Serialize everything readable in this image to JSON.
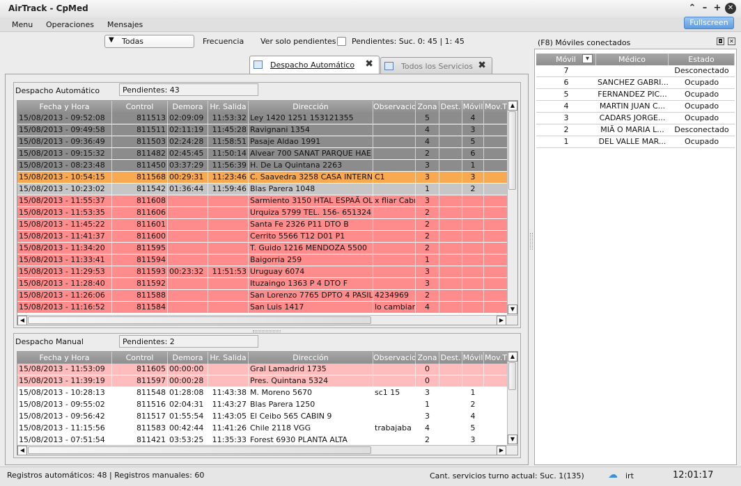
{
  "app": {
    "title": "AirTrack - CpMed",
    "fullscreen_label": "Fullscreen"
  },
  "menu": [
    "Menu",
    "Operaciones",
    "Mensajes"
  ],
  "filter": {
    "selected": "Todas",
    "frecuencia_label": "Frecuencia",
    "ver_pendientes_label": "Ver solo pendientes",
    "pendientes_text": "Pendientes: Suc. 0: 45  |  1: 45"
  },
  "tabs": [
    {
      "label": "Despacho Automático",
      "active": true
    },
    {
      "label": "Todos los Servicios",
      "active": false
    }
  ],
  "auto": {
    "title": "Despacho Automático",
    "pendientes": "Pendientes: 43"
  },
  "manual": {
    "title": "Despacho Manual",
    "pendientes": "Pendientes: 2"
  },
  "columns": [
    "Fecha y Hora",
    "Control",
    "Demora",
    "Hr. Salida",
    "Dirección",
    "Observacion",
    "Zona",
    "Dest.",
    "Móvil",
    "Mov.T"
  ],
  "colors": {
    "dark": "#8c8c8c",
    "orange": "#f9a94f",
    "light": "#c6c6c6",
    "red": "#ff8c8c",
    "pink": "#ffbcbc",
    "white": "#ffffff"
  },
  "auto_rows": [
    [
      "15/08/2013 - 09:52:08",
      "811513",
      "02:09:09",
      "11:53:32",
      "Ley 1420 1251     153121355",
      "",
      "5",
      "",
      "4",
      "",
      "dark"
    ],
    [
      "15/08/2013 - 09:49:58",
      "811511",
      "02:11:19",
      "11:45:28",
      "Ravignani 1354",
      "",
      "4",
      "",
      "3",
      "",
      "dark"
    ],
    [
      "15/08/2013 - 09:36:49",
      "811503",
      "02:24:28",
      "11:58:51",
      "Pasaje Aldao 1991",
      "",
      "4",
      "",
      "5",
      "",
      "dark"
    ],
    [
      "15/08/2013 - 09:15:32",
      "811482",
      "02:45:45",
      "11:50:14",
      "Alvear 700     SANAT PARQUE HAE",
      "",
      "2",
      "",
      "6",
      "",
      "dark"
    ],
    [
      "15/08/2013 - 08:23:48",
      "811450",
      "03:37:29",
      "11:56:39",
      "H. De La Quintana 2263",
      "",
      "3",
      "",
      "1",
      "",
      "dark"
    ],
    [
      "15/08/2013 - 10:54:15",
      "811568",
      "00:29:31",
      "11:23:46",
      "C. Saavedra 3258     CASA INTERN",
      "C1",
      "3",
      "",
      "3",
      "",
      "orange"
    ],
    [
      "15/08/2013 - 10:23:02",
      "811542",
      "01:36:44",
      "11:59:46",
      "Blas Parera 1048",
      "",
      "1",
      "",
      "2",
      "",
      "light"
    ],
    [
      "15/08/2013 - 11:55:37",
      "811608",
      "",
      "",
      "Sarmiento 3150     HTAL ESPAÃ OL",
      "x fliar Cabr",
      "3",
      "",
      "",
      "",
      "red"
    ],
    [
      "15/08/2013 - 11:53:35",
      "811606",
      "",
      "",
      "Urquiza 5799     TEL. 156- 651324",
      "",
      "2",
      "",
      "",
      "",
      "red"
    ],
    [
      "15/08/2013 - 11:45:22",
      "811601",
      "",
      "",
      "Santa Fe 2326     P11 DTO B",
      "",
      "2",
      "",
      "",
      "",
      "red"
    ],
    [
      "15/08/2013 - 11:41:37",
      "811600",
      "",
      "",
      "Cerrito 5566     T12 D01 P1",
      "",
      "2",
      "",
      "",
      "",
      "red"
    ],
    [
      "15/08/2013 - 11:34:20",
      "811595",
      "",
      "",
      "T. Guido 1216     MENDOZA 5500",
      "",
      "2",
      "",
      "",
      "",
      "red"
    ],
    [
      "15/08/2013 - 11:33:41",
      "811594",
      "",
      "",
      "Baigorria 259",
      "",
      "1",
      "",
      "",
      "",
      "red"
    ],
    [
      "15/08/2013 - 11:29:53",
      "811593",
      "00:23:32",
      "11:51:53",
      "Uruguay 6074",
      "",
      "3",
      "",
      "",
      "",
      "red"
    ],
    [
      "15/08/2013 - 11:28:40",
      "811592",
      "",
      "",
      "Ituzaingo 1363     P 4 DTO F",
      "",
      "3",
      "",
      "",
      "",
      "red"
    ],
    [
      "15/08/2013 - 11:26:06",
      "811588",
      "",
      "",
      "San Lorenzo 7765     DPTO 4 PASIL",
      "4234969",
      "2",
      "",
      "",
      "",
      "red"
    ],
    [
      "15/08/2013 - 11:16:52",
      "811584",
      "",
      "",
      "San Luis 1417",
      "lo cambiar",
      "4",
      "",
      "",
      "",
      "red"
    ]
  ],
  "manual_rows": [
    [
      "15/08/2013 - 11:53:09",
      "811605",
      "00:00:00",
      "",
      "Gral  Lamadrid 1735",
      "",
      "0",
      "",
      "",
      "",
      "pink"
    ],
    [
      "15/08/2013 - 11:39:19",
      "811597",
      "00:00:28",
      "",
      "Pres. Quintana 5324",
      "",
      "0",
      "",
      "",
      "",
      "pink"
    ],
    [
      "15/08/2013 - 10:28:13",
      "811548",
      "01:28:08",
      "11:43:38",
      "M. Moreno 5670",
      "sc1        15",
      "3",
      "",
      "1",
      "",
      "white"
    ],
    [
      "15/08/2013 - 09:55:02",
      "811516",
      "02:04:31",
      "11:43:27",
      "Blas Parera 1250",
      "",
      "1",
      "",
      "2",
      "",
      "white"
    ],
    [
      "15/08/2013 - 09:56:42",
      "811517",
      "01:55:54",
      "11:43:05",
      "El Ceibo 565     CABIN 9",
      "",
      "3",
      "",
      "4",
      "",
      "white"
    ],
    [
      "15/08/2013 - 11:15:56",
      "811583",
      "00:42:44",
      "11:41:26",
      "Chile 2118     VGG",
      "trabajaba",
      "4",
      "",
      "5",
      "",
      "white"
    ],
    [
      "15/08/2013 - 07:51:54",
      "811421",
      "03:53:25",
      "11:35:33",
      "Forest 6930     PLANTA ALTA",
      "",
      "2",
      "",
      "3",
      "",
      "white"
    ]
  ],
  "moviles": {
    "title": "(F8) Móviles conectados",
    "columns": [
      "Móvil",
      "Médico",
      "Estado"
    ],
    "rows": [
      [
        "7",
        "",
        "Desconectado"
      ],
      [
        "6",
        "SANCHEZ GABRI...",
        "Ocupado"
      ],
      [
        "5",
        "FERNANDEZ PIC...",
        "Ocupado"
      ],
      [
        "4",
        "MARTIN JUAN C...",
        "Ocupado"
      ],
      [
        "3",
        "CADARS JORGE...",
        "Ocupado"
      ],
      [
        "2",
        "MIÃ O MARIA L...",
        "Desconectado"
      ],
      [
        "1",
        "DEL VALLE  MAR...",
        "Ocupado"
      ]
    ]
  },
  "status": {
    "registros": "Registros automáticos: 48  |  Registros manuales: 60",
    "cant": "Cant. servicios turno actual: Suc. 1(135)",
    "user": "irt",
    "clock": "12:01:17"
  }
}
